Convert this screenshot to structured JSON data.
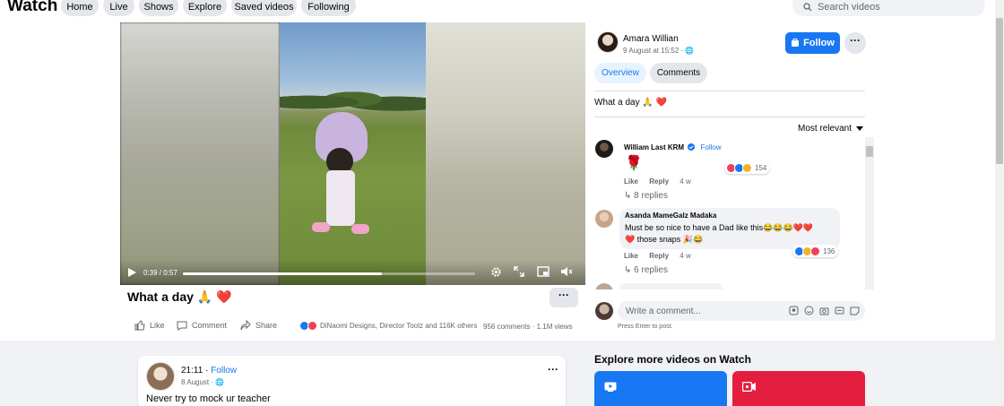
{
  "header": {
    "brand": "Watch",
    "nav": [
      "Home",
      "Live",
      "Shows",
      "Explore",
      "Saved videos",
      "Following"
    ],
    "search_placeholder": "Search videos"
  },
  "video": {
    "time": "0:39 / 0:57",
    "progress_fraction": 0.68
  },
  "post": {
    "title": "What a day 🙏 ❤️",
    "more": "···",
    "actions": [
      "Like",
      "Comment",
      "Share"
    ],
    "reactions_text": "DiNaomi Designs, Director Toolz and 116K others",
    "comments_count": "956 comments",
    "views": "1.1M views"
  },
  "sidebar": {
    "author_name": "Amara Willian",
    "author_time": "9 August at 15:52 · 🌐",
    "follow_label": "Follow",
    "more": "···",
    "tabs": [
      "Overview",
      "Comments"
    ],
    "caption": "What a day 🙏 ❤️",
    "sort_label": "Most relevant",
    "comments": [
      {
        "name": "William Last KRM",
        "follow": "Follow",
        "text": "🌹",
        "reaction_count": "154",
        "like": "Like",
        "reply": "Reply",
        "age": "4 w",
        "replies": "8 replies"
      },
      {
        "name": "Asanda MameGalz Madaka",
        "text_line1": "Must be so nice to have a Dad like this😂😂😂❤️❤️",
        "text_line2": "❤️ those snaps 🎉😂",
        "reaction_count": "136",
        "like": "Like",
        "reply": "Reply",
        "age": "4 w",
        "replies": "6 replies"
      }
    ],
    "composer_placeholder": "Write a comment...",
    "press_enter": "Press Enter to post."
  },
  "feed_card": {
    "time": "21:11",
    "follow": "Follow",
    "date": "8 August · 🌐",
    "more": "···",
    "text": "Never try to mock ur teacher"
  },
  "explore": {
    "title": "Explore more videos on Watch"
  },
  "colors": {
    "accent": "#1877f2",
    "red_tile": "#e41e3f",
    "page_bg": "#f0f2f5"
  }
}
